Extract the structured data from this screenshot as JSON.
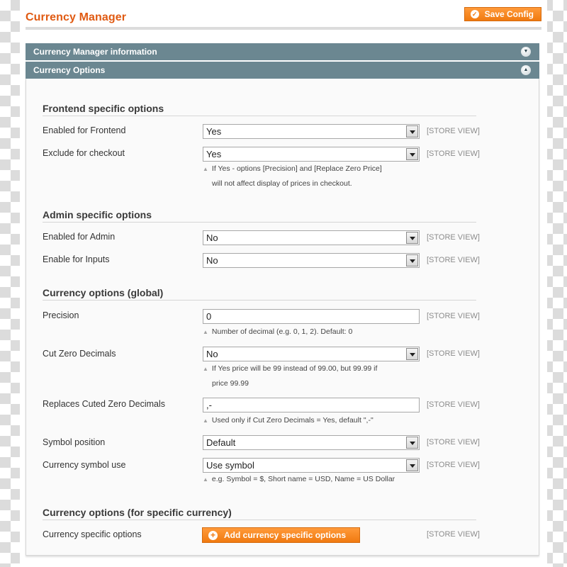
{
  "header": {
    "title": "Currency Manager",
    "save_label": "Save Config",
    "save_icon": "checkmark-circle-icon"
  },
  "sections": [
    {
      "title": "Currency Manager information",
      "state": "collapsed",
      "toggle_icon": "chevron-down-circle-icon"
    },
    {
      "title": "Currency Options",
      "state": "expanded",
      "toggle_icon": "chevron-up-circle-icon"
    }
  ],
  "scope_label": "[STORE VIEW]",
  "groups": [
    {
      "title": "Frontend specific options",
      "rows": [
        {
          "label": "Enabled for Frontend",
          "type": "select",
          "value": "Yes",
          "scope": "[STORE VIEW]"
        },
        {
          "label": "Exclude for checkout",
          "type": "select",
          "value": "Yes",
          "scope": "[STORE VIEW]",
          "note": [
            "If Yes - options [Precision] and [Replace Zero Price]",
            "will not affect display of prices in checkout."
          ]
        }
      ]
    },
    {
      "title": "Admin specific options",
      "rows": [
        {
          "label": "Enabled for Admin",
          "type": "select",
          "value": "No",
          "scope": "[STORE VIEW]"
        },
        {
          "label": "Enable for Inputs",
          "type": "select",
          "value": "No",
          "scope": "[STORE VIEW]"
        }
      ]
    },
    {
      "title": "Currency options (global)",
      "rows": [
        {
          "label": "Precision",
          "type": "text",
          "value": "0",
          "scope": "[STORE VIEW]",
          "note": [
            "Number of decimal (e.g. 0, 1, 2). Default: 0"
          ]
        },
        {
          "label": "Cut Zero Decimals",
          "type": "select",
          "value": "No",
          "scope": "[STORE VIEW]",
          "note": [
            "If Yes price will be 99 instead of 99.00, but 99.99 if",
            "price 99.99"
          ]
        },
        {
          "label": "Replaces Cuted Zero Decimals",
          "type": "text",
          "value": ",-",
          "scope": "[STORE VIEW]",
          "note": [
            "Used only if Cut Zero Decimals = Yes, default \",-\""
          ]
        },
        {
          "label": "Symbol position",
          "type": "select",
          "value": "Default",
          "scope": "[STORE VIEW]"
        },
        {
          "label": "Currency symbol use",
          "type": "select",
          "value": "Use symbol",
          "scope": "[STORE VIEW]",
          "note": [
            "e.g. Symbol = $, Short name = USD, Name = US Dollar"
          ]
        }
      ]
    },
    {
      "title": "Currency options (for specific currency)",
      "rows": [
        {
          "label": "Currency specific options",
          "type": "button",
          "value": "Add currency specific options",
          "scope": "[STORE VIEW]"
        }
      ]
    }
  ],
  "colors": {
    "title": "#e05a12",
    "button": "#f07a10",
    "section_header": "#6b8791"
  }
}
